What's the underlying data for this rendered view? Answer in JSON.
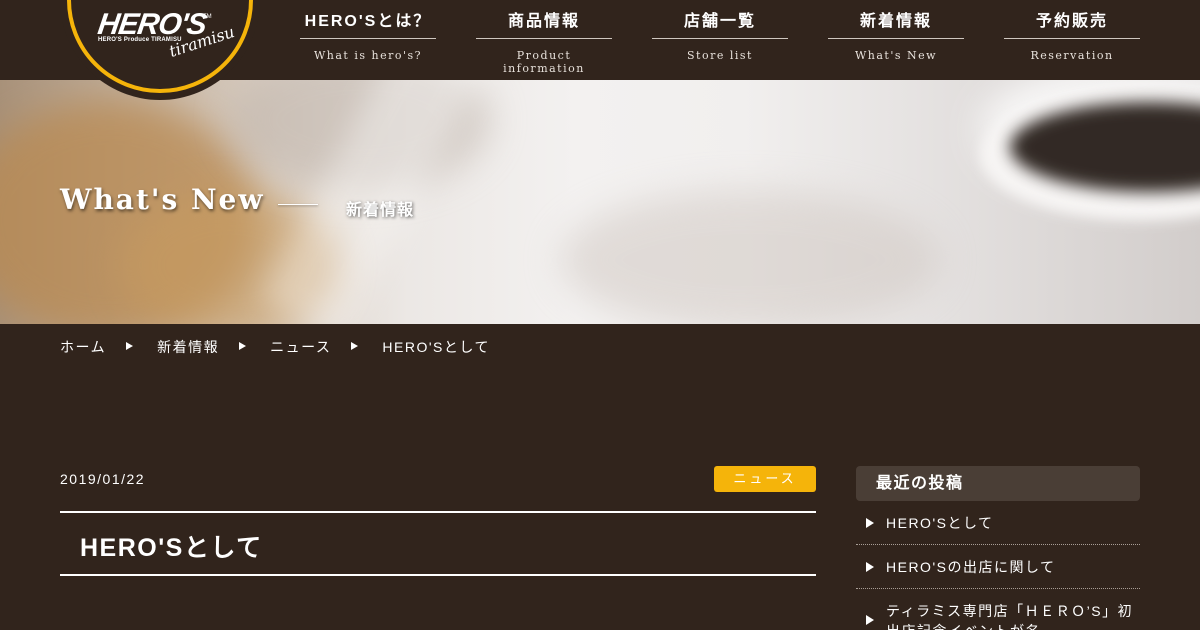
{
  "logo": {
    "main": "HERO'S",
    "tm": "TM",
    "sub": "HERO'S Produce TIRAMISU",
    "script": "tiramisu"
  },
  "nav": [
    {
      "jp": "HERO'Sとは？",
      "en": "What is hero's?"
    },
    {
      "jp": "商品情報",
      "en": "Product information"
    },
    {
      "jp": "店舗一覧",
      "en": "Store list"
    },
    {
      "jp": "新着情報",
      "en": "What's New"
    },
    {
      "jp": "予約販売",
      "en": "Reservation"
    }
  ],
  "hero": {
    "title": "What's New",
    "subtitle": "新着情報"
  },
  "breadcrumb": {
    "home": "ホーム",
    "news_list": "新着情報",
    "category": "ニュース",
    "current": "HERO'Sとして"
  },
  "article": {
    "date": "2019/01/22",
    "category": "ニュース",
    "title": "HERO'Sとして"
  },
  "sidebar": {
    "heading": "最近の投稿",
    "posts": [
      "HERO'Sとして",
      "HERO'Sの出店に関して",
      "ティラミス専門店「ＨＥＲＯ’S」初出店記念イベントが名"
    ]
  },
  "colors": {
    "background": "#31241c",
    "accent": "#f5b40a",
    "sidebar_head": "#4a3e36",
    "text": "#ffffff"
  }
}
